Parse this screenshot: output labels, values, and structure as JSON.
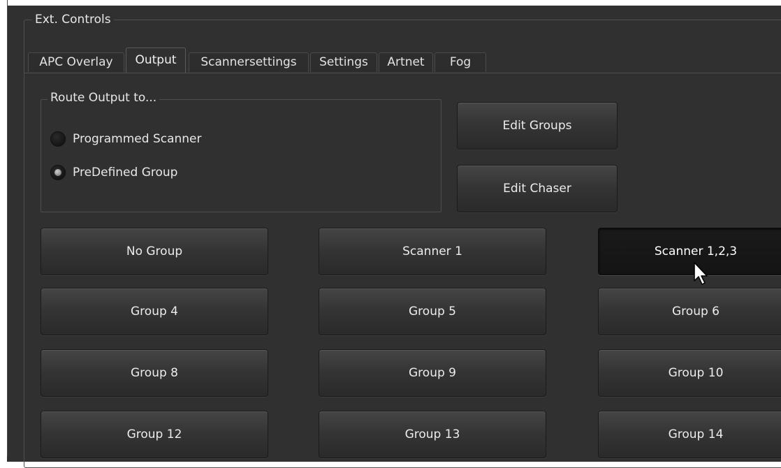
{
  "groupbox": {
    "title": "Ext. Controls"
  },
  "tabs": [
    {
      "label": "APC Overlay",
      "active": false
    },
    {
      "label": "Output",
      "active": true
    },
    {
      "label": "Scannersettings",
      "active": false
    },
    {
      "label": "Settings",
      "active": false
    },
    {
      "label": "Artnet",
      "active": false
    },
    {
      "label": "Fog",
      "active": false
    }
  ],
  "route": {
    "title": "Route Output to...",
    "options": [
      {
        "label": "Programmed Scanner",
        "checked": false
      },
      {
        "label": "PreDefined Group",
        "checked": true
      }
    ]
  },
  "actions": {
    "edit_groups": "Edit Groups",
    "edit_chaser": "Edit Chaser"
  },
  "group_buttons": [
    {
      "label": "No Group",
      "pressed": false
    },
    {
      "label": "Scanner 1",
      "pressed": false
    },
    {
      "label": "Scanner 1,2,3",
      "pressed": true
    },
    {
      "label": "Group 4",
      "pressed": false
    },
    {
      "label": "Group 5",
      "pressed": false
    },
    {
      "label": "Group 6",
      "pressed": false
    },
    {
      "label": "Group 8",
      "pressed": false
    },
    {
      "label": "Group 9",
      "pressed": false
    },
    {
      "label": "Group 10",
      "pressed": false
    },
    {
      "label": "Group 12",
      "pressed": false
    },
    {
      "label": "Group 13",
      "pressed": false
    },
    {
      "label": "Group 14",
      "pressed": false
    }
  ],
  "icons": {
    "cursor": "mouse-pointer-icon"
  }
}
